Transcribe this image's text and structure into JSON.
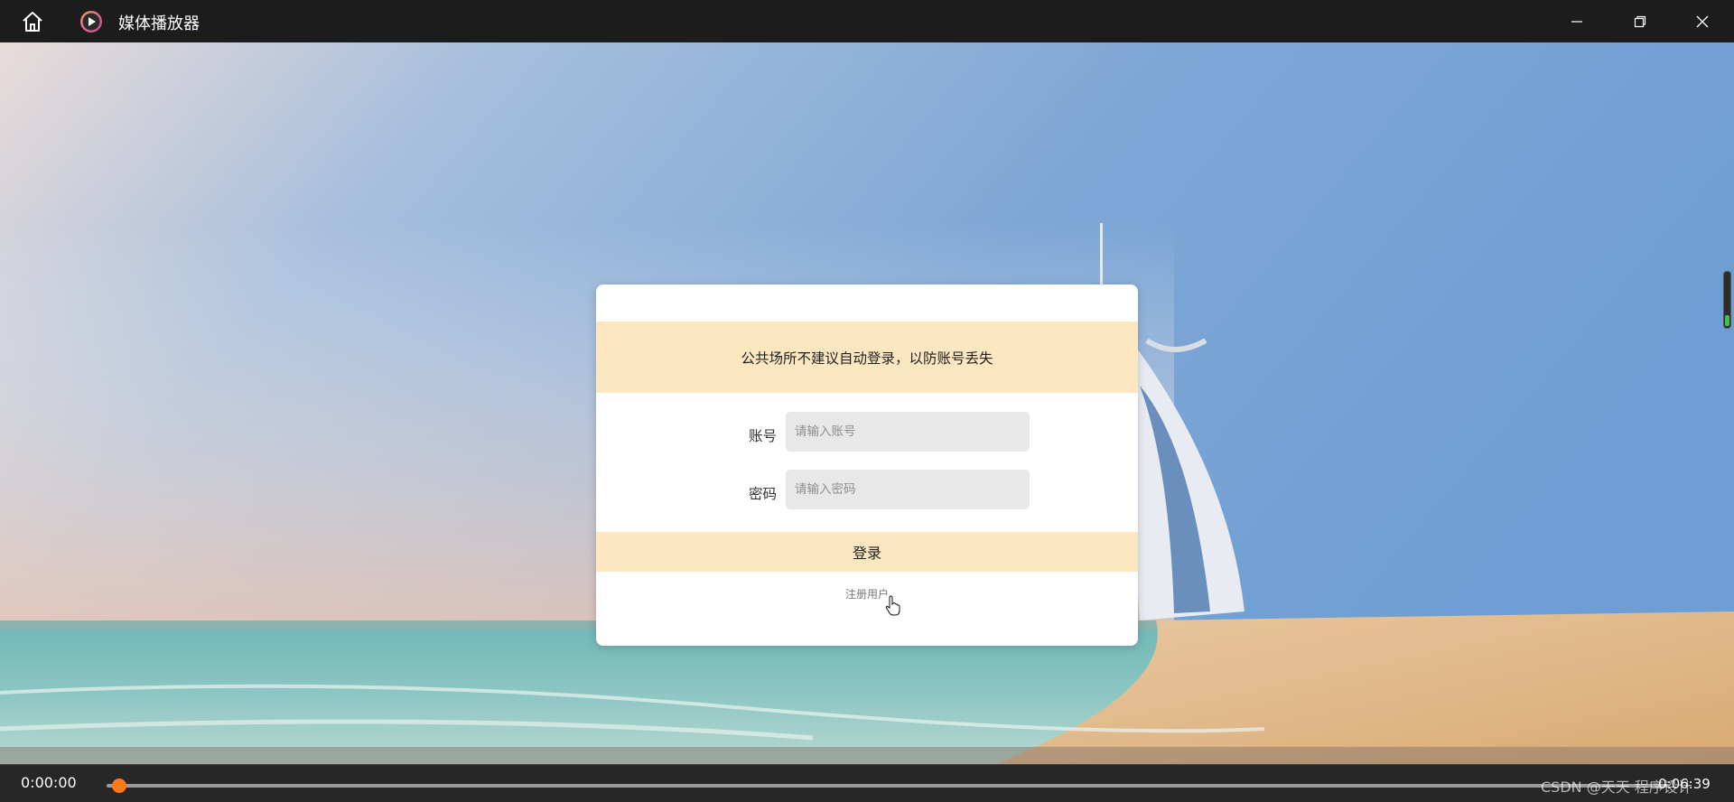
{
  "window": {
    "title": "媒体播放器",
    "icons": [
      "home-icon",
      "media-player-logo-icon",
      "minimize-icon",
      "restore-icon",
      "close-icon"
    ]
  },
  "login": {
    "notice": "公共场所不建议自动登录，以防账号丢失",
    "account_label": "账号",
    "account_placeholder": "请输入账号",
    "account_value": "",
    "password_label": "密码",
    "password_placeholder": "请输入密码",
    "password_value": "",
    "login_button": "登录",
    "register_link": "注册用户"
  },
  "player": {
    "current_time": "0:00:00",
    "total_time": "0:06:39",
    "progress": 0.0,
    "watermark": "CSDN @天天 程序设计"
  },
  "colors": {
    "titlebar": "#1c1c1c",
    "accent_orange": "#ff7a1a",
    "notice_bg": "#fde7c0",
    "input_bg": "#e8e8e8"
  }
}
